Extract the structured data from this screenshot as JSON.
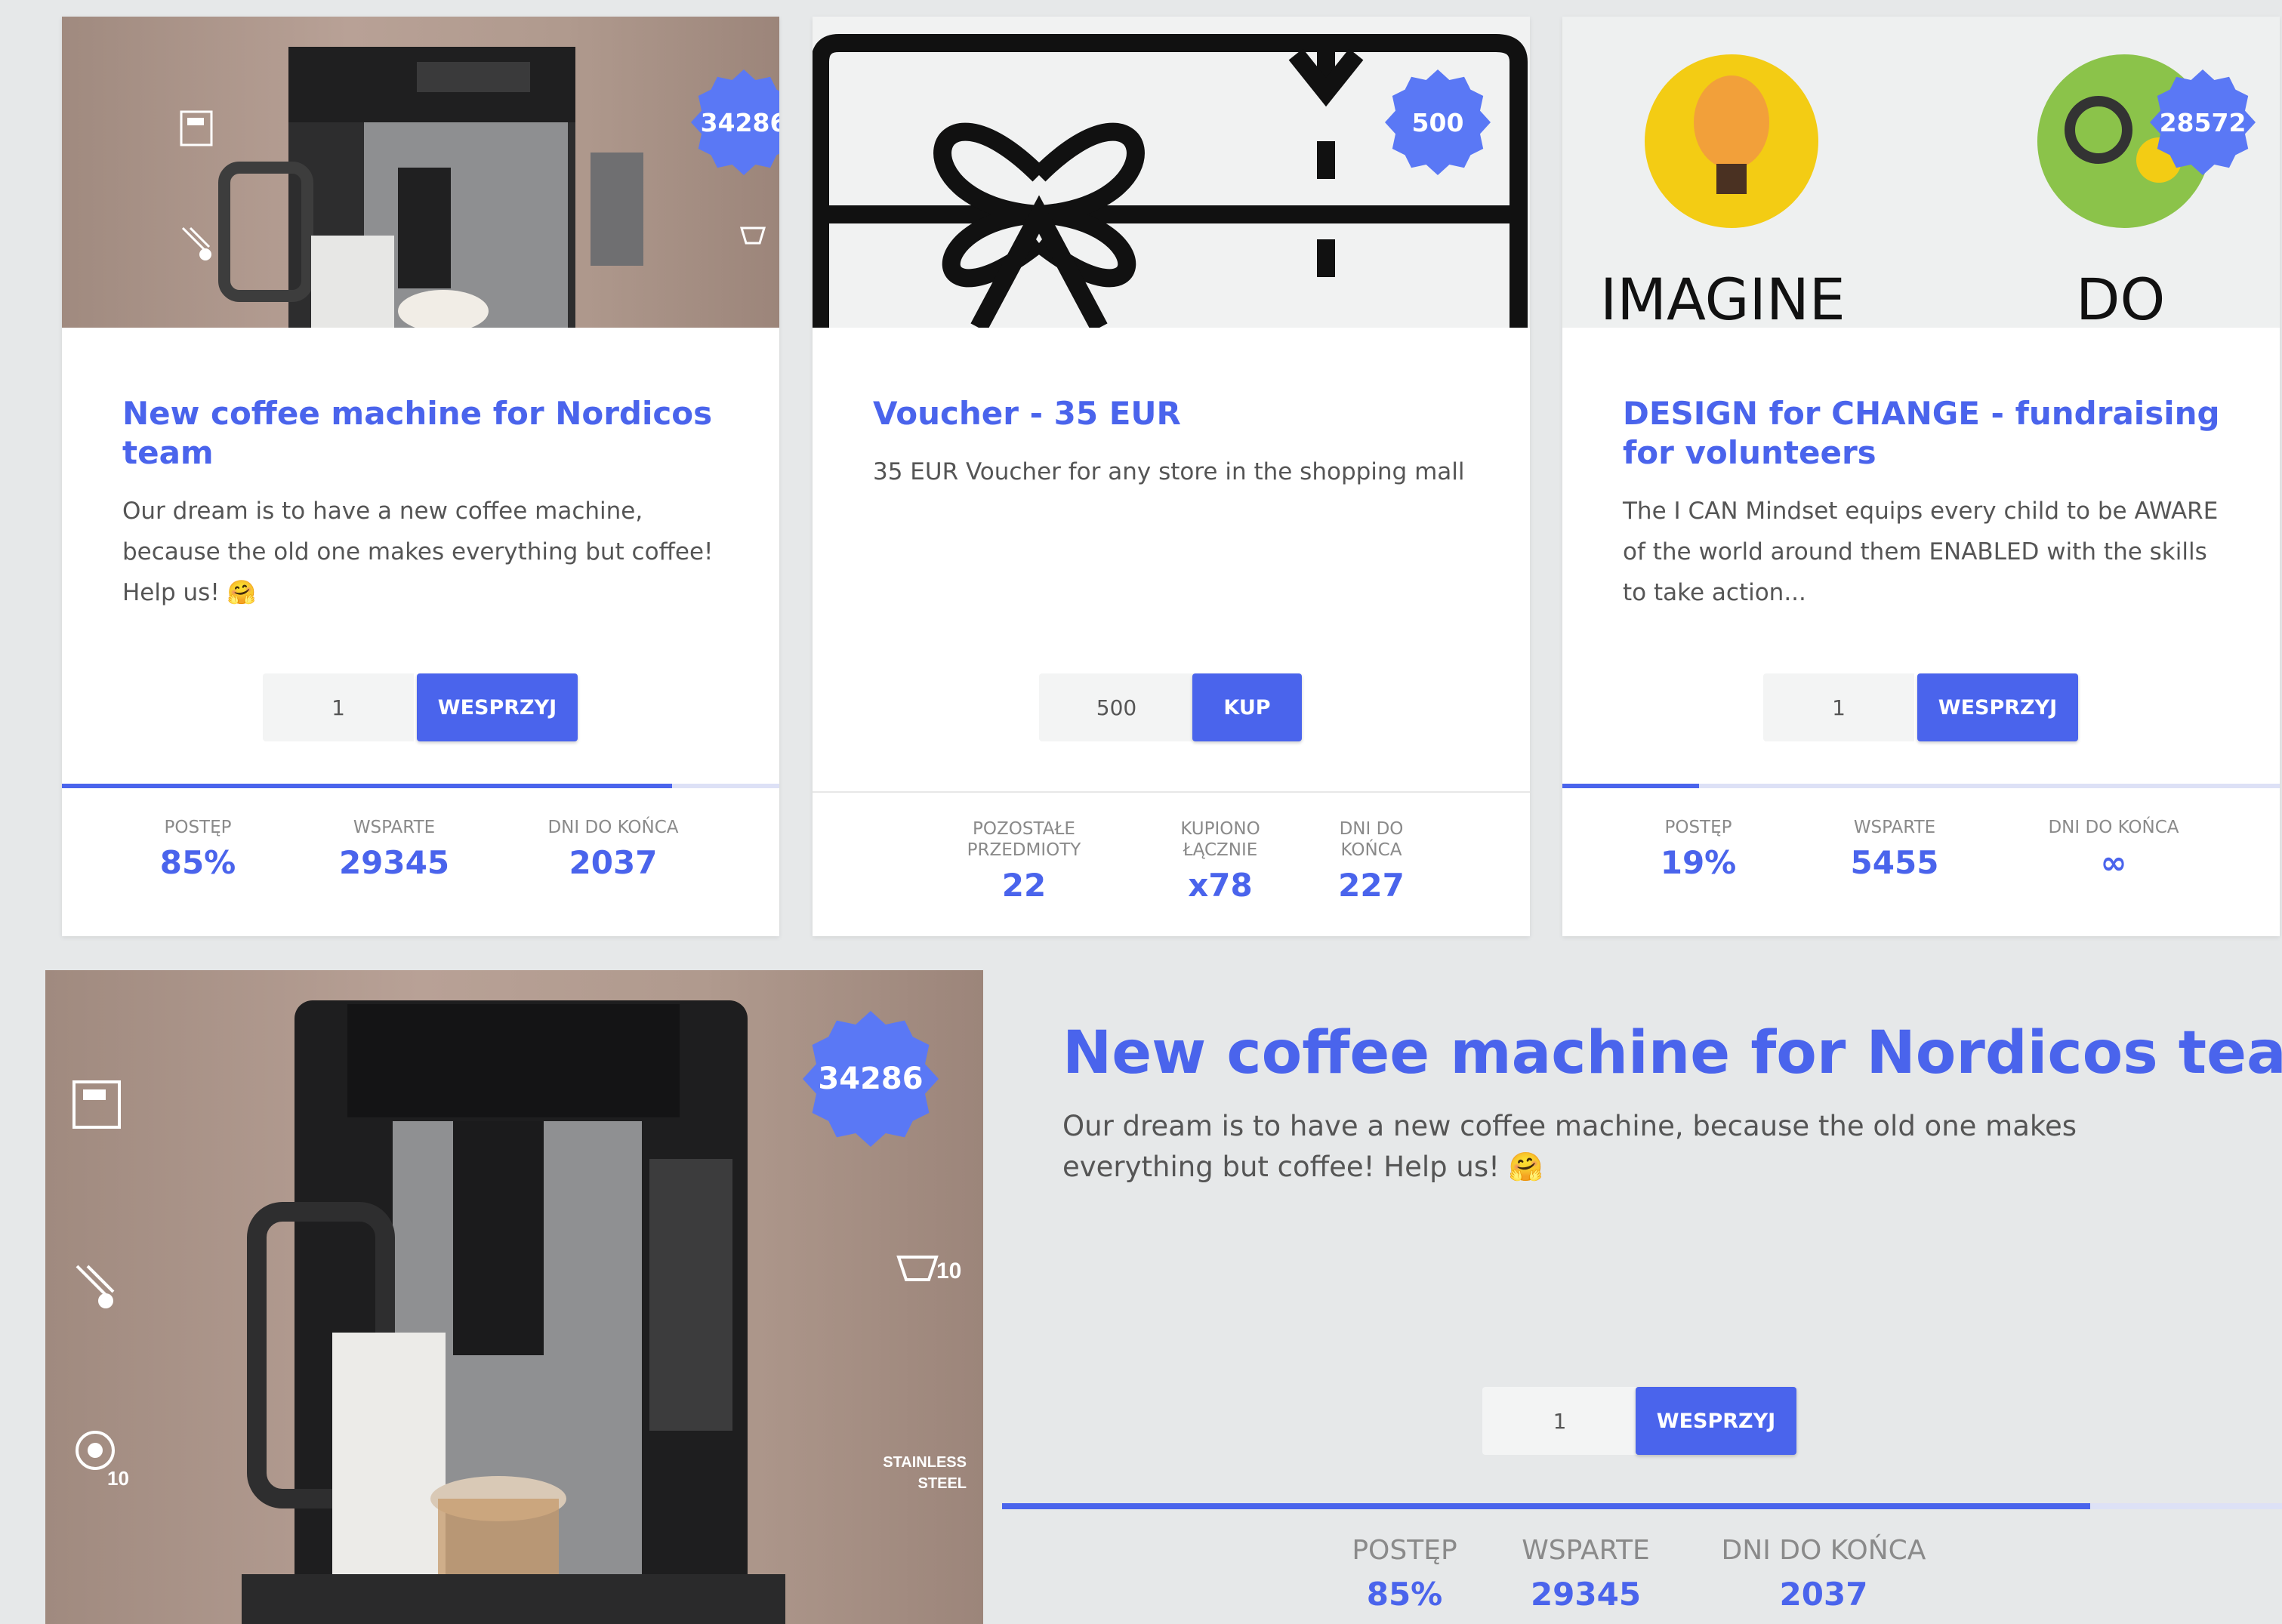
{
  "cards": [
    {
      "badge": "34286",
      "title": "New coffee machine for Nordicos team",
      "description": "Our dream is to have a new coffee machine, because the old one makes everything but coffee! Help us! 🤗",
      "quantity": "1",
      "button": "WESPRZYJ",
      "progress": 0.85,
      "stats": [
        {
          "label": "POSTĘP",
          "value": "85%"
        },
        {
          "label": "WSPARTE",
          "value": "29345"
        },
        {
          "label": "DNI DO KOŃCA",
          "value": "2037"
        }
      ]
    },
    {
      "badge": "500",
      "title": "Voucher - 35 EUR",
      "description": "35 EUR Voucher for any store in the shopping mall",
      "quantity": "500",
      "button": "KUP",
      "stats": [
        {
          "label": "POZOSTAŁE PRZEDMIOTY",
          "value": "22"
        },
        {
          "label": "KUPIONO ŁĄCZNIE",
          "value": "x78"
        },
        {
          "label": "DNI DO KOŃCA",
          "value": "227"
        }
      ]
    },
    {
      "badge": "28572",
      "image_text_left": "IMAGINE",
      "image_text_right": "DO",
      "title": "DESIGN for CHANGE - fundraising for volunteers",
      "description": "The I CAN Mindset equips every child to be AWARE of the world around them ENABLED with the skills to take action...",
      "quantity": "1",
      "button": "WESPRZYJ",
      "progress": 0.19,
      "stats": [
        {
          "label": "POSTĘP",
          "value": "19%"
        },
        {
          "label": "WSPARTE",
          "value": "5455"
        },
        {
          "label": "DNI DO KOŃCA",
          "value": "∞"
        }
      ]
    }
  ],
  "featured": {
    "badge": "34286",
    "title": "New coffee machine for Nordicos team",
    "description": "Our dream is to have a new coffee machine, because the old one makes everything but coffee! Help us! 🤗",
    "quantity": "1",
    "button": "WESPRZYJ",
    "progress": 0.85,
    "stats": [
      {
        "label": "POSTĘP",
        "value": "85%"
      },
      {
        "label": "WSPARTE",
        "value": "29345"
      },
      {
        "label": "DNI DO KOŃCA",
        "value": "2037"
      }
    ],
    "image_labels": {
      "stainless": "STAINLESS STEEL",
      "ten_a": "10",
      "ten_b": "10"
    }
  },
  "colors": {
    "accent": "#4a64ec",
    "badge": "#5a78f5",
    "background": "#e6e8e9"
  }
}
